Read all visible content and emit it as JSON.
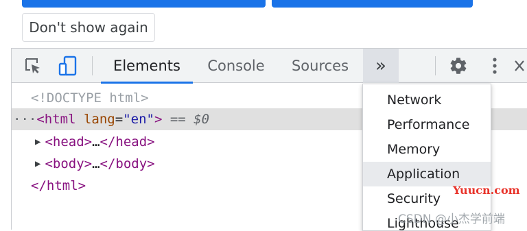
{
  "banner": {
    "dont_show_label": "Don't show again"
  },
  "toolbar": {
    "tabs": [
      {
        "label": "Elements"
      },
      {
        "label": "Console"
      },
      {
        "label": "Sources"
      }
    ],
    "more_tabs_glyph": "»",
    "icons": [
      "inspect-element-icon",
      "device-toolbar-icon",
      "gear-icon",
      "kebab-menu-icon",
      "close-icon"
    ]
  },
  "tree": {
    "doctype": "<!DOCTYPE html>",
    "html_ellipsis": "···",
    "html_open": "<html",
    "html_attr_name": " lang",
    "html_attr_eq": "=",
    "html_attr_value": "\"en\"",
    "html_open_close": ">",
    "html_ref": " == $0",
    "head_open": "<head>",
    "head_dots": "…",
    "head_close": "</head>",
    "body_open": "<body>",
    "body_dots": "…",
    "body_close": "</body>",
    "html_close": "</html>"
  },
  "menu": {
    "items": [
      {
        "label": "Network"
      },
      {
        "label": "Performance"
      },
      {
        "label": "Memory"
      },
      {
        "label": "Application"
      },
      {
        "label": "Security"
      },
      {
        "label": "Lighthouse"
      }
    ],
    "hovered_index": 3
  },
  "watermarks": {
    "site": "Yuucn.com",
    "csdn": "CSDN @小杰学前端"
  },
  "colors": {
    "accent": "#1a73e8",
    "tag": "#881280",
    "attr_name": "#994500",
    "attr_value": "#1a1aa6"
  }
}
